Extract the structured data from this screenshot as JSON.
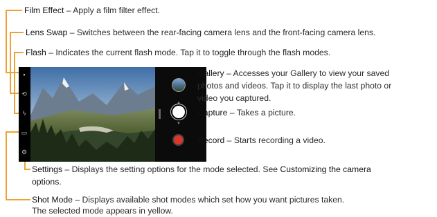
{
  "annotations": {
    "film_effect": {
      "name": "Film Effect",
      "desc": " – Apply a film filter effect."
    },
    "lens_swap": {
      "name": "Lens Swap",
      "desc": " – Switches between the rear-facing camera lens and the front-facing camera lens."
    },
    "flash": {
      "name": "Flash",
      "desc": " – Indicates the current flash mode. Tap it to toggle through the flash modes."
    },
    "gallery": {
      "name": "Gallery",
      "desc_lines": [
        " – Accesses your Gallery to view your saved",
        "photos and videos. Tap it to display the last photo or",
        "video you captured."
      ]
    },
    "capture": {
      "name": "Capture",
      "desc": " – Takes a picture."
    },
    "record": {
      "name": "Record",
      "desc": " – Starts recording a video."
    },
    "settings": {
      "name": "Settings",
      "desc": " – Displays the setting options for the mode selected. See ",
      "link": "Customizing the camera",
      "link2": "options",
      "tail": "."
    },
    "shot_mode": {
      "name": "Shot Mode",
      "desc": " – Displays available shot modes which set how you want pictures taken.",
      "line2": "The selected mode appears in yellow."
    }
  },
  "icons": {
    "film": "film-icon",
    "lens_swap": "camera-swap-icon",
    "flash": "flash-icon",
    "shot_mode": "shot-mode-icon",
    "settings": "gear-icon"
  },
  "colors": {
    "callout_line": "#f0a133",
    "record": "#d9372b"
  }
}
